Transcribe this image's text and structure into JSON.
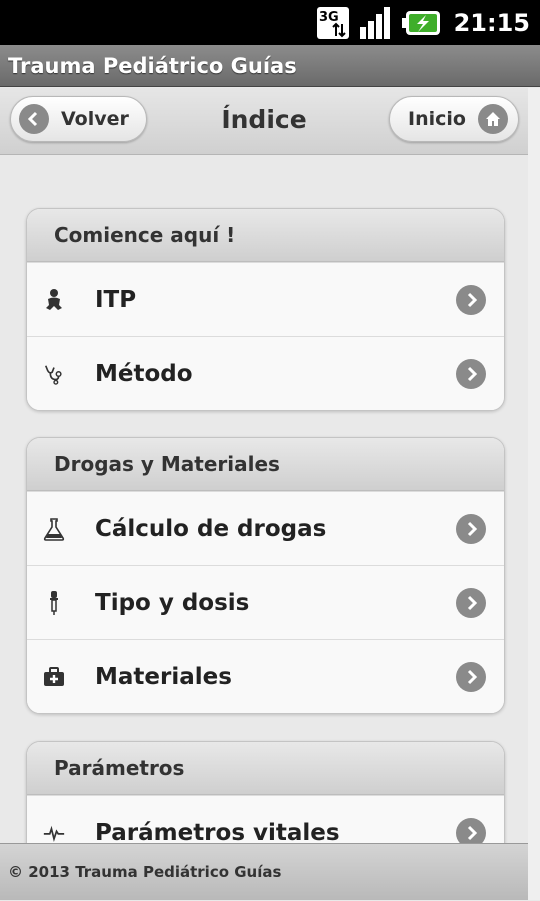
{
  "status_bar": {
    "network": "3G",
    "time": "21:15"
  },
  "app": {
    "title": "Trauma Pediátrico Guías"
  },
  "header": {
    "back_label": "Volver",
    "title": "Índice",
    "home_label": "Inicio"
  },
  "groups": [
    {
      "title": "Comience aquí !",
      "items": [
        {
          "label": "ITP",
          "icon": "baby-icon"
        },
        {
          "label": "Método",
          "icon": "stethoscope-icon"
        }
      ]
    },
    {
      "title": "Drogas y Materiales",
      "items": [
        {
          "label": "Cálculo de drogas",
          "icon": "flask-icon"
        },
        {
          "label": "Tipo y dosis",
          "icon": "dropper-icon"
        },
        {
          "label": "Materiales",
          "icon": "medical-kit-icon"
        }
      ]
    },
    {
      "title": "Parámetros",
      "items": [
        {
          "label": "Parámetros vitales",
          "icon": "heartbeat-icon"
        }
      ]
    }
  ],
  "footer": {
    "text": "© 2013 Trauma  Pediátrico  Guías"
  }
}
